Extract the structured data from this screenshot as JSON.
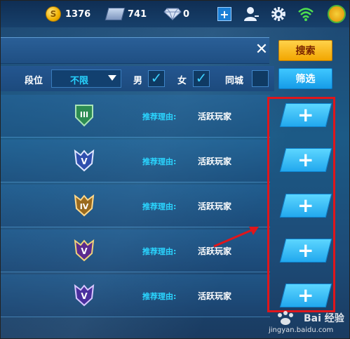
{
  "topbar": {
    "coin_icon_glyph": "S",
    "coins": "1376",
    "tickets": "741",
    "gems": "0",
    "add_glyph": "+"
  },
  "search": {
    "close_glyph": "✕",
    "search_label": "搜索"
  },
  "filters": {
    "rank_label": "段位",
    "rank_value": "不限",
    "male_label": "男",
    "male_checked_glyph": "✓",
    "female_label": "女",
    "female_checked_glyph": "✓",
    "same_city_label": "同城",
    "filter_label": "筛选"
  },
  "players": [
    {
      "rank_numeral": "III",
      "reason_label": "推荐理由:",
      "reason": "活跃玩家",
      "add_glyph": "+"
    },
    {
      "rank_numeral": "V",
      "reason_label": "推荐理由:",
      "reason": "活跃玩家",
      "add_glyph": "+"
    },
    {
      "rank_numeral": "IV",
      "reason_label": "推荐理由:",
      "reason": "活跃玩家",
      "add_glyph": "+"
    },
    {
      "rank_numeral": "V",
      "reason_label": "推荐理由:",
      "reason": "活跃玩家",
      "add_glyph": "+"
    },
    {
      "rank_numeral": "V",
      "reason_label": "推荐理由:",
      "reason": "活跃玩家",
      "add_glyph": "+"
    }
  ],
  "watermark": {
    "brand": "Bai 经验",
    "url": "jingyan.baidu.com"
  },
  "colors": {
    "accent_cyan": "#2ad5ff",
    "search_button": "#f2a600",
    "filter_button": "#169ce8",
    "highlight_box": "#e0161b"
  }
}
